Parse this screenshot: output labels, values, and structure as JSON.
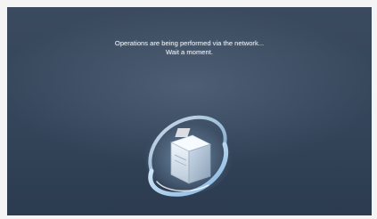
{
  "dialog": {
    "message_line1": "Operations are being performed via the network...",
    "message_line2": "Wait a moment."
  },
  "icons": {
    "busy": "printer-with-spinning-ring-icon"
  },
  "colors": {
    "background": "#34455a",
    "text": "#eef2f6",
    "ring_glow": "#bfe2ff"
  }
}
